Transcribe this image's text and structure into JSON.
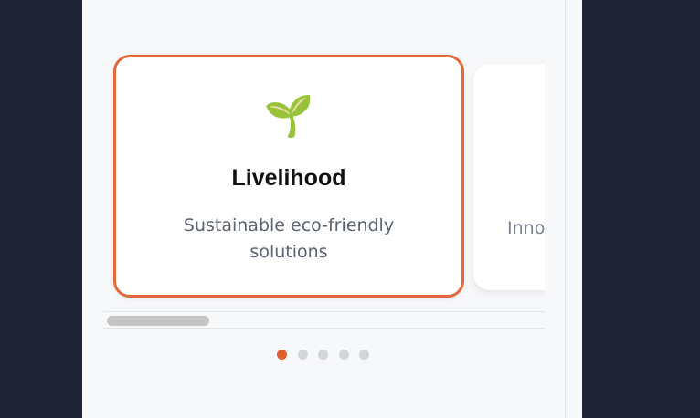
{
  "carousel": {
    "cards": [
      {
        "icon": "🌱",
        "icon_name": "seedling-icon",
        "title": "Livelihood",
        "description": "Sustainable eco-friendly solutions",
        "active": true
      },
      {
        "description_visible": "Innov",
        "active": false
      }
    ],
    "pagination": {
      "total": 5,
      "current": 1
    }
  },
  "colors": {
    "background": "#1f2437",
    "panel": "#f7f8fa",
    "accent": "#e4693a",
    "dot_inactive": "#d3d5da"
  }
}
